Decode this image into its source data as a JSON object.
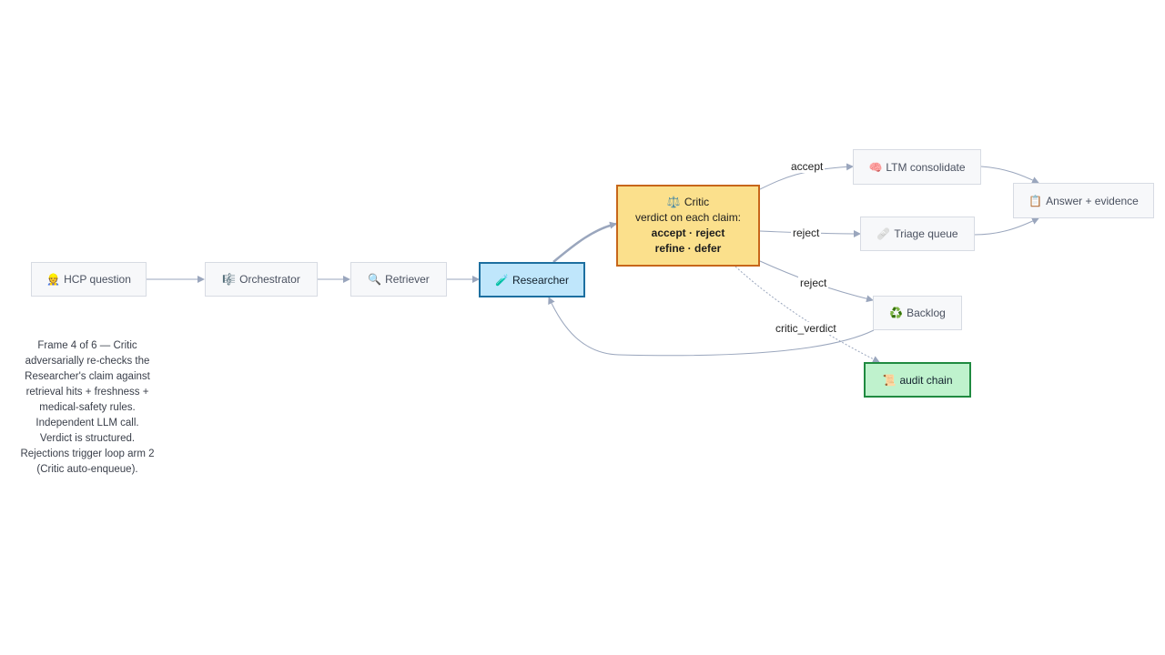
{
  "nodes": {
    "hcp_question": {
      "icon": "👷",
      "label": "HCP question"
    },
    "orchestrator": {
      "icon": "🎼",
      "label": "Orchestrator"
    },
    "retriever": {
      "icon": "🔍",
      "label": "Retriever"
    },
    "researcher": {
      "icon": "🧪",
      "label": "Researcher"
    },
    "critic": {
      "icon": "⚖️",
      "title": "Critic",
      "line1": "verdict on each claim:",
      "line2": "accept · reject",
      "line3": "refine · defer"
    },
    "ltm_consolidate": {
      "icon": "🧠",
      "label": "LTM consolidate"
    },
    "triage_queue": {
      "icon": "🩹",
      "label": "Triage queue"
    },
    "answer_evidence": {
      "icon": "📋",
      "label": "Answer + evidence"
    },
    "backlog": {
      "icon": "♻️",
      "label": "Backlog"
    },
    "audit_chain": {
      "icon": "📜",
      "label": "audit chain"
    }
  },
  "edge_labels": {
    "accept": "accept",
    "reject_triage": "reject",
    "reject_backlog": "reject",
    "critic_verdict": "critic_verdict"
  },
  "caption": "Frame 4 of 6 — Critic adversarially re-checks the Researcher's claim against retrieval hits + freshness + medical-safety rules. Independent LLM call. Verdict is structured. Rejections trigger loop arm 2 (Critic auto-enqueue).",
  "colors": {
    "edge": "#9aa6bd",
    "active_fill": "#bfe6fb",
    "active_border": "#1d6fa0",
    "critic_fill": "#fbe08c",
    "critic_border": "#c7661a",
    "done_fill": "#bff2cd",
    "done_border": "#1f8a40"
  }
}
